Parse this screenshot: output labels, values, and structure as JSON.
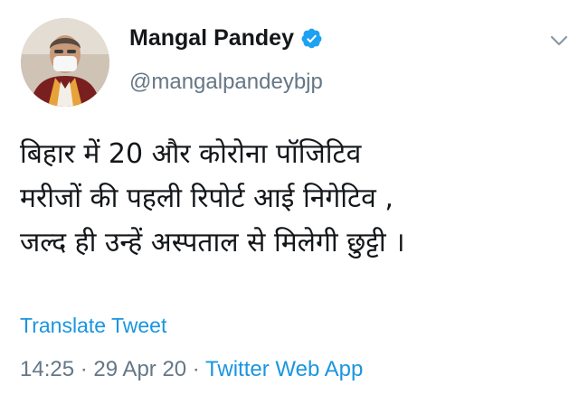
{
  "user": {
    "name": "Mangal Pandey",
    "handle": "@mangalpandeybjp",
    "verified": true,
    "avatar_icon": "profile-photo"
  },
  "tweet": {
    "lines": [
      "बिहार में 20 और कोरोना पॉजिटिव",
      "मरीजों की पहली रिपोर्ट आई निगेटिव ,",
      "जल्द ही उन्हें अस्पताल से मिलेगी छुट्टी ।"
    ]
  },
  "translate_label": "Translate Tweet",
  "meta": {
    "time": "14:25",
    "sep1": " · ",
    "date": "29 Apr 20",
    "sep2": " · ",
    "source": "Twitter Web App"
  },
  "icons": {
    "verified": "verified-badge-icon",
    "menu": "chevron-down-icon"
  },
  "colors": {
    "link": "#1b95e0",
    "secondary": "#657786",
    "text": "#14171a"
  }
}
